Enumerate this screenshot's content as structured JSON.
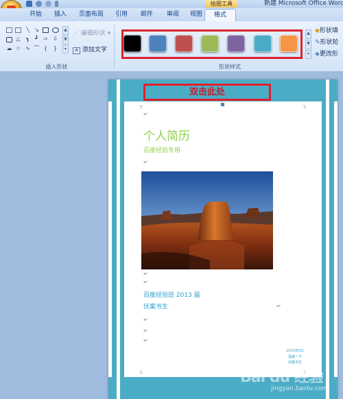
{
  "window": {
    "context_tab_label": "绘图工具",
    "doc_title": "新建 Microsoft Office Word"
  },
  "tabs": [
    "开始",
    "插入",
    "页面布局",
    "引用",
    "邮件",
    "审阅",
    "视图",
    "格式"
  ],
  "active_tab": "格式",
  "ribbon": {
    "insert_shapes": {
      "edit_shape_label": "编辑形状",
      "add_text_label": "添加文字",
      "group_label": "插入形状"
    },
    "shape_styles": {
      "group_label": "形状样式",
      "swatches": [
        "#000000",
        "#4f81bd",
        "#c0504d",
        "#9bbb59",
        "#8064a2",
        "#4bacc6",
        "#f79646"
      ],
      "fill_label": "形状填",
      "outline_label": "形状轮",
      "change_label": "更改形"
    }
  },
  "document": {
    "header_text": "双击此处",
    "resume_title": "个人简历",
    "subtitle": "百度经验专用",
    "class_line": "百度经验班 2013 届",
    "name_line": "伏案书生",
    "date_small": "2013/8/22",
    "small_line2": "百度一下",
    "small_line3": "伏案书生",
    "paragraph_mark": "↵"
  },
  "watermark": {
    "brand": "Bai du 经验",
    "url": "jingyan.baidu.com"
  }
}
